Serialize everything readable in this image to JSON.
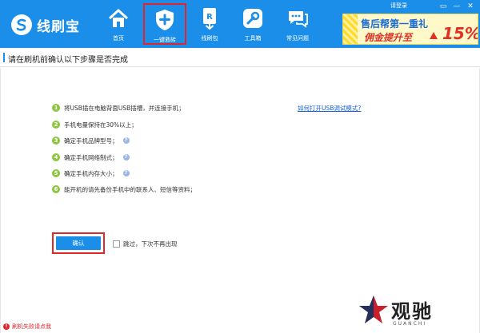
{
  "app": {
    "name": "线刷宝",
    "login_label": "请登录",
    "window_controls": [
      "▭",
      "—",
      "✕"
    ]
  },
  "nav": [
    {
      "label": "首页",
      "icon": "home-icon",
      "active": false
    },
    {
      "label": "一键救砖",
      "icon": "shield-plus-icon",
      "active": true
    },
    {
      "label": "线刷包",
      "icon": "rom-package-icon",
      "active": false
    },
    {
      "label": "工具箱",
      "icon": "wrench-icon",
      "active": false
    },
    {
      "label": "常见问题",
      "icon": "chat-icon",
      "active": false
    }
  ],
  "banner": {
    "line1": "售后帮第一重礼",
    "line2": "佣金提升至",
    "percent": "15%"
  },
  "page": {
    "title": "请在刷机前确认以下步骤是否完成",
    "help_link": "如何打开USB调试模式?"
  },
  "steps": [
    {
      "num": "1",
      "text": "将USB插在电脑背面USB插槽，并连接手机；",
      "help": false
    },
    {
      "num": "2",
      "text": "手机电量保持在30%以上；",
      "help": false
    },
    {
      "num": "3",
      "text": "确定手机品牌型号；",
      "help": true
    },
    {
      "num": "4",
      "text": "确定手机网络制式；",
      "help": true
    },
    {
      "num": "5",
      "text": "确定手机内存大小；",
      "help": true
    },
    {
      "num": "6",
      "text": "能开机的请先备份手机中的联系人、短信等资料；",
      "help": false
    }
  ],
  "actions": {
    "confirm_label": "确认",
    "skip_label": "跳过，下次不再出现"
  },
  "status": {
    "text": "刷机失败请点我"
  },
  "watermark": {
    "title": "观驰",
    "sub": "GUANCHI"
  },
  "colors": {
    "primary": "#1a8ee8",
    "highlight": "#e0262b",
    "step_badge": "#8cc63f",
    "link": "#1a5fd8"
  }
}
